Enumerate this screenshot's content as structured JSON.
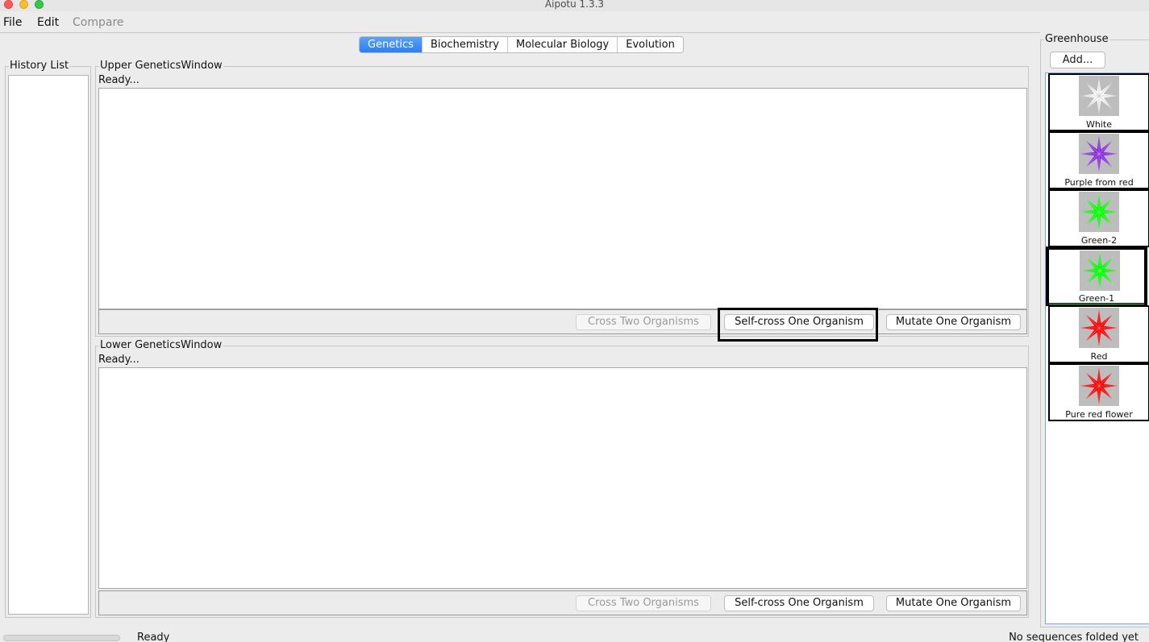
{
  "window": {
    "title": "Aipotu 1.3.3"
  },
  "menu": {
    "file": "File",
    "edit": "Edit",
    "compare": "Compare"
  },
  "tabs": [
    {
      "label": "Genetics",
      "active": true
    },
    {
      "label": "Biochemistry",
      "active": false
    },
    {
      "label": "Molecular Biology",
      "active": false
    },
    {
      "label": "Evolution",
      "active": false
    }
  ],
  "history": {
    "title": "History List"
  },
  "upper": {
    "title": "Upper GeneticsWindow",
    "status": "Ready...",
    "cross_label": "Cross Two Organisms",
    "selfcross_label": "Self-cross One Organism",
    "mutate_label": "Mutate One Organism"
  },
  "lower": {
    "title": "Lower GeneticsWindow",
    "status": "Ready...",
    "cross_label": "Cross Two Organisms",
    "selfcross_label": "Self-cross One Organism",
    "mutate_label": "Mutate One Organism"
  },
  "greenhouse": {
    "title": "Greenhouse",
    "add_label": "Add...",
    "organisms": [
      {
        "name": "White",
        "color": "#ffffff",
        "selected": false
      },
      {
        "name": "Purple from red",
        "color": "#8a2be2",
        "selected": false
      },
      {
        "name": "Green-2",
        "color": "#00ff00",
        "selected": false
      },
      {
        "name": "Green-1",
        "color": "#00ff00",
        "selected": true
      },
      {
        "name": "Red",
        "color": "#ff0000",
        "selected": false
      },
      {
        "name": "Pure red flower",
        "color": "#ff0000",
        "selected": false
      }
    ]
  },
  "statusbar": {
    "left": "Ready",
    "right": "No sequences folded yet"
  }
}
